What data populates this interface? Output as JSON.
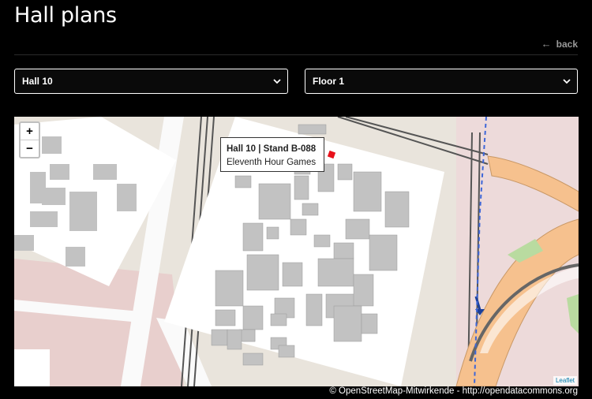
{
  "page": {
    "title": "Hall plans",
    "back_label": "back"
  },
  "filters": {
    "hall": {
      "selected": "Hall 10"
    },
    "floor": {
      "selected": "Floor 1"
    }
  },
  "map": {
    "zoom_in": "+",
    "zoom_out": "−",
    "popup": {
      "title": "Hall 10 | Stand B-088",
      "subtitle": "Eleventh Hour Games"
    },
    "leaflet_label": "Leaflet",
    "attribution": "© OpenStreetMap-Mitwirkende - http://opendatacommons.org"
  },
  "icons": {
    "back": "arrow-left-icon",
    "select": "chevron-down-icon",
    "marker": "stand-marker"
  },
  "colors": {
    "marker": "#e8111b",
    "road": "#f6c18e",
    "green": "#b9dba0",
    "building": "#bdbdbd"
  }
}
